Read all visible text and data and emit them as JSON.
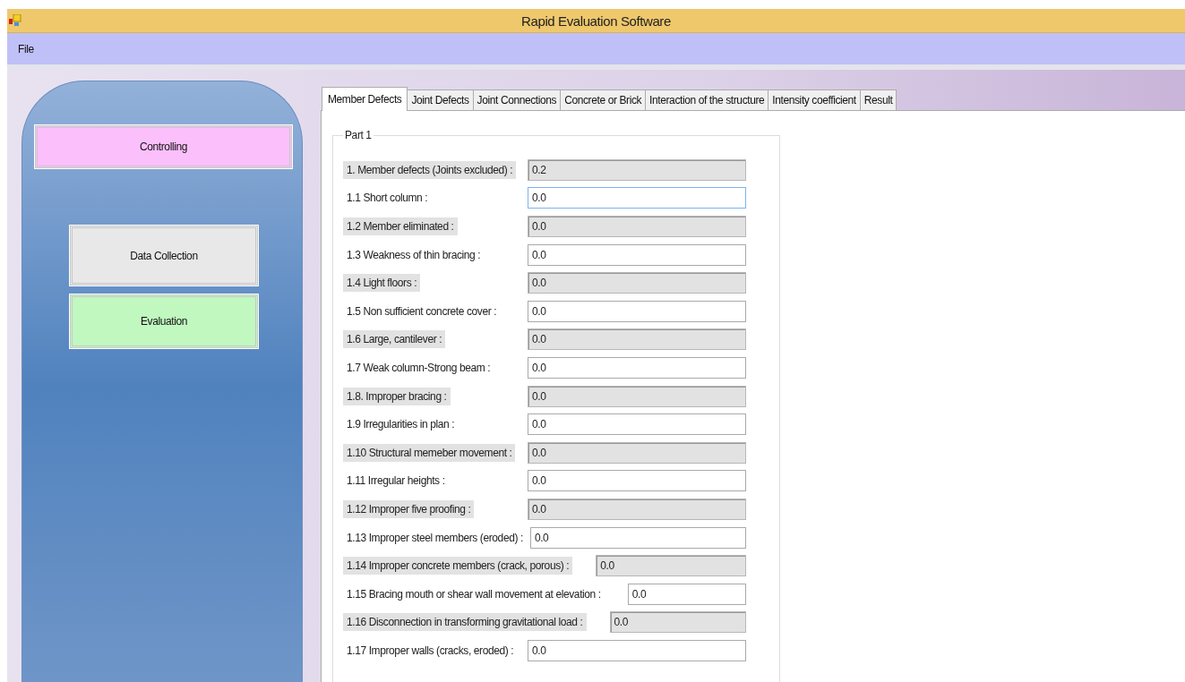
{
  "window": {
    "title": "Rapid Evaluation Software"
  },
  "menu": [
    "File"
  ],
  "sidebar": {
    "buttons": [
      {
        "label": "Controlling",
        "color": "#fbc0fb"
      },
      {
        "label": "Data Collection",
        "color": "#e8e8e8"
      },
      {
        "label": "Evaluation",
        "color": "#c0f8c0"
      }
    ]
  },
  "tabs": [
    {
      "label": "Member Defects",
      "selected": true
    },
    {
      "label": "Joint Defects",
      "selected": false
    },
    {
      "label": "Joint Connections",
      "selected": false
    },
    {
      "label": "Concrete or Brick",
      "selected": false
    },
    {
      "label": "Interaction of the structure",
      "selected": false
    },
    {
      "label": "Intensity coefficient",
      "selected": false
    },
    {
      "label": "Result",
      "selected": false
    }
  ],
  "group": {
    "title": "Part 1",
    "rows": [
      {
        "label": "1. Member defects (Joints excluded) :",
        "value": "0.2",
        "disabled": true,
        "focused": false
      },
      {
        "label": "1.1 Short column :",
        "value": "0.0",
        "disabled": false,
        "focused": true
      },
      {
        "label": "1.2 Member eliminated :",
        "value": "0.0",
        "disabled": true,
        "focused": false
      },
      {
        "label": "1.3 Weakness of thin bracing :",
        "value": "0.0",
        "disabled": false,
        "focused": false
      },
      {
        "label": "1.4 Light floors :",
        "value": "0.0",
        "disabled": true,
        "focused": false
      },
      {
        "label": "1.5 Non sufficient concrete cover :",
        "value": "0.0",
        "disabled": false,
        "focused": false
      },
      {
        "label": "1.6 Large, cantilever :",
        "value": "0.0",
        "disabled": true,
        "focused": false
      },
      {
        "label": "1.7 Weak column-Strong beam :",
        "value": "0.0",
        "disabled": false,
        "focused": false
      },
      {
        "label": "1.8. Improper bracing :",
        "value": "0.0",
        "disabled": true,
        "focused": false
      },
      {
        "label": "1.9 Irregularities in plan :",
        "value": "0.0",
        "disabled": false,
        "focused": false
      },
      {
        "label": "1.10 Structural memeber movement :",
        "value": "0.0",
        "disabled": true,
        "focused": false
      },
      {
        "label": "1.11 Irregular heights :",
        "value": "0.0",
        "disabled": false,
        "focused": false
      },
      {
        "label": "1.12 Improper five proofing :",
        "value": "0.0",
        "disabled": true,
        "focused": false
      },
      {
        "label": "1.13 Improper steel members (eroded) :",
        "value": "0.0",
        "disabled": false,
        "focused": false
      },
      {
        "label": "1.14 Improper concrete members (crack, porous) :",
        "value": "0.0",
        "disabled": true,
        "focused": false
      },
      {
        "label": "1.15 Bracing mouth or shear wall movement at elevation :",
        "value": "0.0",
        "disabled": false,
        "focused": false
      },
      {
        "label": "1.16 Disconnection in transforming gravitational load :",
        "value": "0.0",
        "disabled": true,
        "focused": false
      },
      {
        "label": "1.17 Improper walls (cracks, eroded) :",
        "value": "0.0",
        "disabled": false,
        "focused": false
      }
    ]
  }
}
